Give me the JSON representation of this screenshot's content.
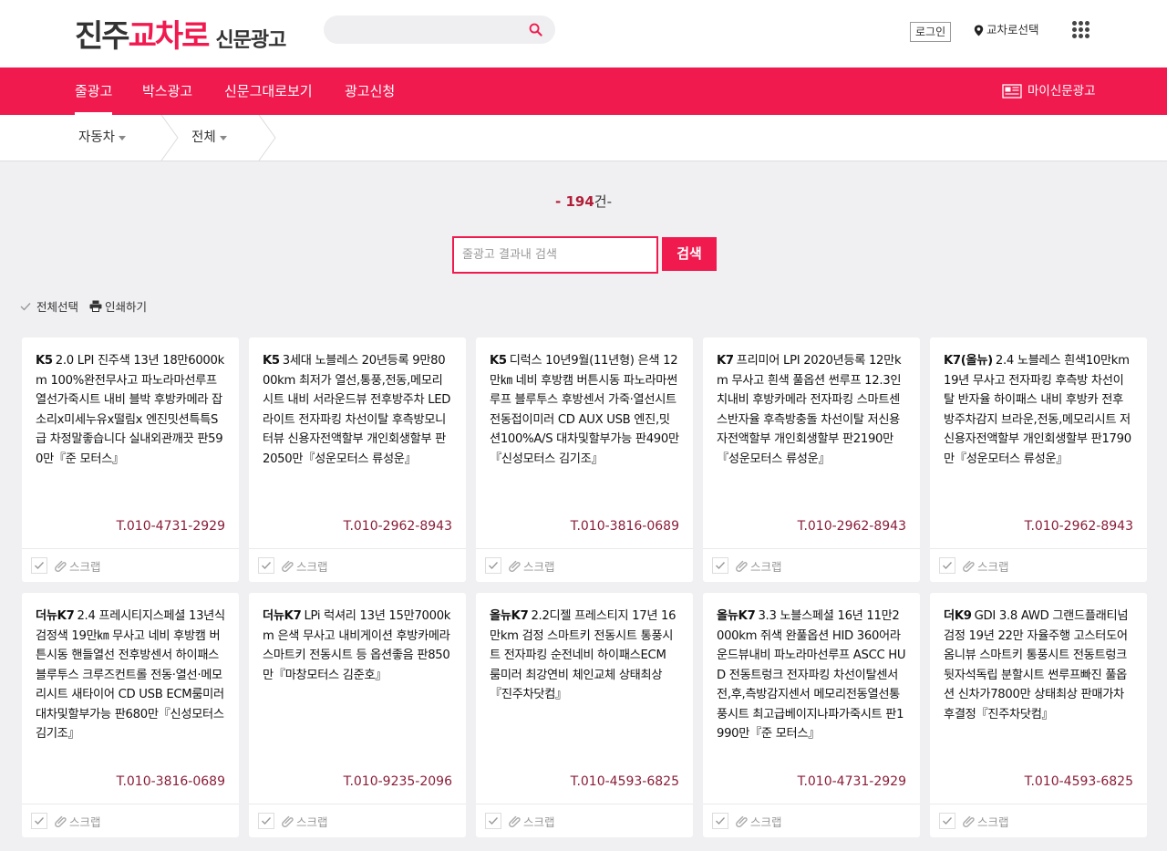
{
  "header": {
    "logo_part1": "진주",
    "logo_part2": "교차로",
    "logo_part3": "신문광고",
    "search_placeholder": "",
    "login_label": "로그인",
    "region_label": "교차로선택"
  },
  "nav": {
    "tabs": [
      {
        "label": "줄광고",
        "active": true
      },
      {
        "label": "박스광고",
        "active": false
      },
      {
        "label": "신문그대로보기",
        "active": false
      },
      {
        "label": "광고신청",
        "active": false
      }
    ],
    "my_paper_label": "마이신문광고"
  },
  "breadcrumb": {
    "category": "자동차",
    "subcategory": "전체"
  },
  "results": {
    "dash_left": "- ",
    "count": "194",
    "unit": "건-",
    "search_placeholder": "줄광고 결과내 검색",
    "search_button": "검색"
  },
  "toolbar": {
    "select_all": "전체선택",
    "print": "인쇄하기"
  },
  "colors": {
    "brand": "#f01a4f",
    "phone": "#8a1d39",
    "count": "#b11e38"
  },
  "cards": [
    {
      "model": "K5",
      "text": "2.0 LPI 진주색 13년 18만6000km 100%완전무사고 파노라마선루프 열선가죽시트 내비 블박 후방카메라 잡소리x미세누유x떨림x 엔진밋션특특S급 차정말좋습니다 실내외관깨끗 판590만『준 모터스』",
      "tel": "T.010-4731-2929",
      "scrap": "스크랩"
    },
    {
      "model": "K5",
      "text": "3세대 노블레스 20년등록 9만8000km 최저가 열선,통풍,전동,메모리시트 내비 서라운드뷰 전후방주차 LED라이트 전자파킹 차선이탈 후측방모니터뷰 신용자전액할부 개인회생할부 판2050만『성운모터스 류성운』",
      "tel": "T.010-2962-8943",
      "scrap": "스크랩"
    },
    {
      "model": "K5",
      "text": "디럭스 10년9월(11년형) 은색 12만㎞ 네비 후방캠 버튼시동 파노라마썬루프 블루투스 후방센서 가죽·열선시트 전동접이미러 CD AUX USB 엔진,밋션100%A/S 대차및할부가능 판490만『신성모터스 김기조』",
      "tel": "T.010-3816-0689",
      "scrap": "스크랩"
    },
    {
      "model": "K7",
      "text": "프리미어 LPI 2020년등록 12만km 무사고 흰색 풀옵션 썬루프 12.3인치내비 후방카메라 전자파킹 스마트센스반자율 후측방충돌 차선이탈 저신용자전액할부 개인회생할부 판2190만『성운모터스 류성운』",
      "tel": "T.010-2962-8943",
      "scrap": "스크랩"
    },
    {
      "model": "K7(올뉴)",
      "text": "2.4 노블레스 흰색10만km 19년 무사고 전자파킹 후측방 차선이탈 반자율 하이패스 내비 후방카 전후방주차감지 브라운,전동,메모리시트 저신용자전액할부 개인회생할부 판1790만『성운모터스 류성운』",
      "tel": "T.010-2962-8943",
      "scrap": "스크랩"
    },
    {
      "model": "더뉴K7",
      "text": "2.4 프레시티지스페셜 13년식 검정색 19만㎞ 무사고 네비 후방캠 버튼시동 핸들열선 전후방센서 하이패스 블루투스 크루즈컨트롤 전동·열선·메모리시트 새타이어 CD USB ECM룸미러 대차및할부가능 판680만『신성모터스 김기조』",
      "tel": "T.010-3816-0689",
      "scrap": "스크랩"
    },
    {
      "model": "더뉴K7",
      "text": "LPi 럭셔리 13년 15만7000km 은색 무사고 내비게이션 후방카메라 스마트키 전동시트 등 옵션좋음 판850만『마창모터스 김준호』",
      "tel": "T.010-9235-2096",
      "scrap": "스크랩"
    },
    {
      "model": "올뉴K7",
      "text": "2.2디젤 프레스티지 17년 16만km 검정 스마트키 전동시트 통풍시트 전자파킹 순전네비 하이패스ECM 룸미러 최강연비 체인교체 상태최상『진주차닷컴』",
      "tel": "T.010-4593-6825",
      "scrap": "스크랩"
    },
    {
      "model": "올뉴K7",
      "text": "3.3 노블스페셜 16년 11만2000km 쥐색 완풀옵션 HID 360어라운드뷰내비 파노라마선루프 ASCC HUD 전동트렁크 전자파킹 차선이탈센서 전,후,측방감지센서 메모리전동열선통풍시트 최고급베이지나파가죽시트 판1990만『준 모터스』",
      "tel": "T.010-4731-2929",
      "scrap": "스크랩"
    },
    {
      "model": "더K9",
      "text": "GDI 3.8 AWD 그랜드플래티넘 검정 19년 22만 자율주행 고스터도어 옴니뷰 스마트키 통풍시트 전동트렁크 뒷자석독립 분할시트 썬루프빠진 풀옵션 신차가7800만 상태최상 판매가차후결정『진주차닷컴』",
      "tel": "T.010-4593-6825",
      "scrap": "스크랩"
    }
  ]
}
